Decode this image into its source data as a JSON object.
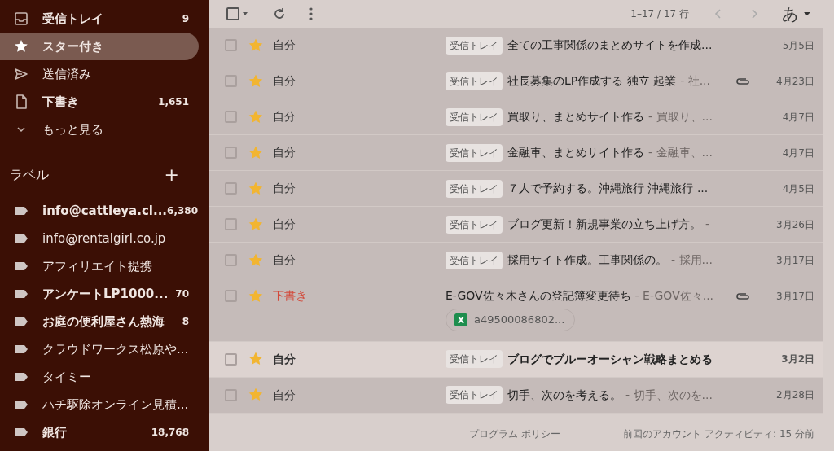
{
  "sidebar": {
    "folders": [
      {
        "kind": "inbox",
        "label": "受信トレイ",
        "count": "9",
        "unread": true,
        "selected": false
      },
      {
        "kind": "star",
        "label": "スター付き",
        "unread": true,
        "selected": true
      },
      {
        "kind": "send",
        "label": "送信済み",
        "unread": false,
        "selected": false
      },
      {
        "kind": "file",
        "label": "下書き",
        "count": "1,651",
        "unread": true,
        "selected": false
      },
      {
        "kind": "chevron",
        "label": "もっと見る",
        "unread": false,
        "selected": false
      }
    ],
    "labels_heading": "ラベル",
    "add_label": "+",
    "labels": [
      {
        "label": "info@cattleya.cl...",
        "count": "6,380",
        "unread": true
      },
      {
        "label": "info@rentalgirl.co.jp",
        "unread": false
      },
      {
        "label": "アフィリエイト提携",
        "unread": false
      },
      {
        "label": "アンケートLP1000...",
        "count": "70",
        "unread": true
      },
      {
        "label": "お庭の便利屋さん熱海",
        "count": "8",
        "unread": true
      },
      {
        "label": "クラウドワークス松原や...",
        "unread": false
      },
      {
        "label": "タイミー",
        "unread": false
      },
      {
        "label": "ハチ駆除オンライン見積...",
        "unread": false
      },
      {
        "label": "銀行",
        "count": "18,768",
        "unread": true
      }
    ]
  },
  "toolbar": {
    "select_all_checked": false,
    "range": "1–17 / 17 行",
    "input_mode": "あ"
  },
  "messages": [
    {
      "sender": "自分",
      "draft": false,
      "label": "受信トレイ",
      "subject": "全ての工事関係のまとめサイトを作成...",
      "attachment": false,
      "date": "5月5日",
      "unread": false,
      "starred": true
    },
    {
      "sender": "自分",
      "draft": false,
      "label": "受信トレイ",
      "subject": "社長募集のLP作成する 独立 起業",
      "snippet": "- 社...",
      "attachment": true,
      "date": "4月23日",
      "unread": false,
      "starred": true
    },
    {
      "sender": "自分",
      "draft": false,
      "label": "受信トレイ",
      "subject": "買取り、まとめサイト作る",
      "snippet": "- 買取り、...",
      "attachment": false,
      "date": "4月7日",
      "unread": false,
      "starred": true
    },
    {
      "sender": "自分",
      "draft": false,
      "label": "受信トレイ",
      "subject": "金融車、まとめサイト作る",
      "snippet": "- 金融車、...",
      "attachment": false,
      "date": "4月7日",
      "unread": false,
      "starred": true
    },
    {
      "sender": "自分",
      "draft": false,
      "label": "受信トレイ",
      "subject": "７人で予約する。沖縄旅行 沖縄旅行 ...",
      "attachment": false,
      "date": "4月5日",
      "unread": false,
      "starred": true
    },
    {
      "sender": "自分",
      "draft": false,
      "label": "受信トレイ",
      "subject": "ブログ更新！新規事業の立ち上げ方。",
      "snippet": "-",
      "attachment": false,
      "date": "3月26日",
      "unread": false,
      "starred": true
    },
    {
      "sender": "自分",
      "draft": false,
      "label": "受信トレイ",
      "subject": "採用サイト作成。工事関係の。",
      "snippet": "- 採用...",
      "attachment": false,
      "date": "3月17日",
      "unread": false,
      "starred": true
    },
    {
      "sender": "下書き",
      "draft": true,
      "subject": "E-GOV佐々木さんの登記簿変更待ち",
      "snippet": "- E-GOV佐々...",
      "attachment": true,
      "attachment_chip": "a49500086802...",
      "date": "3月17日",
      "unread": false,
      "starred": true
    },
    {
      "sender": "自分",
      "draft": false,
      "label": "受信トレイ",
      "subject": "ブログでブルーオーシャン戦略まとめる",
      "attachment": false,
      "date": "3月2日",
      "unread": true,
      "starred": true
    },
    {
      "sender": "自分",
      "draft": false,
      "label": "受信トレイ",
      "subject": "切手、次のを考える。",
      "snippet": "- 切手、次のを...",
      "attachment": false,
      "date": "2月28日",
      "unread": false,
      "starred": true
    }
  ],
  "footer": {
    "policy": "プログラム ポリシー",
    "activity": "前回のアカウント アクティビティ: 15 分前"
  }
}
